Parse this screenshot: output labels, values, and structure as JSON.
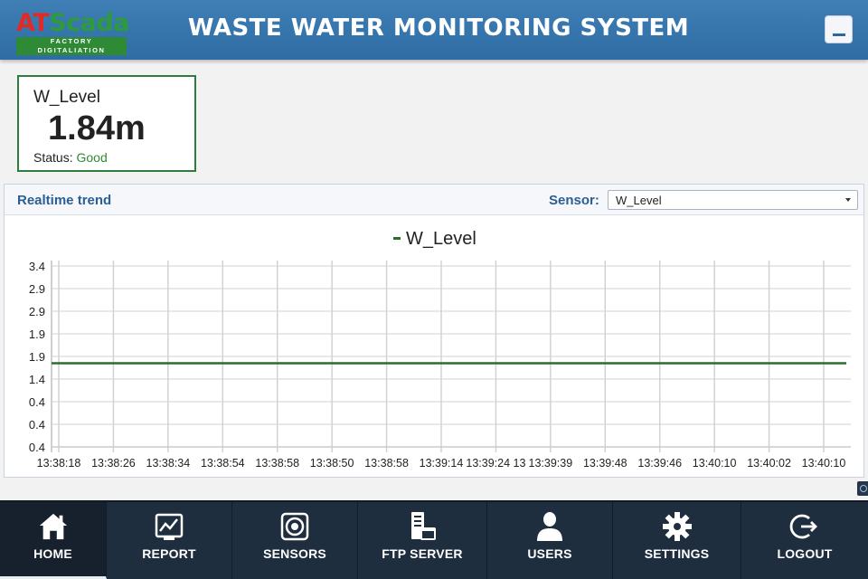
{
  "header": {
    "logo_at": "AT",
    "logo_scada": "Scada",
    "logo_tagline": "FACTORY DIGITALIATION",
    "title": "WASTE WATER MONITORING SYSTEM",
    "minimize_icon": "minimize-icon"
  },
  "value_card": {
    "label": "W_Level",
    "value": "1.84m",
    "status_label": "Status:",
    "status_value": "Good"
  },
  "trend": {
    "title": "Realtime trend",
    "sensor_label": "Sensor:",
    "sensor_selected": "W_Level"
  },
  "chart_data": {
    "type": "line",
    "legend": "W_Level",
    "legend_placement": "top-center",
    "grid": true,
    "series": [
      {
        "name": "W_Level",
        "color": "#2a6e2f",
        "values": [
          1.75,
          1.75,
          1.75,
          1.75,
          1.75,
          1.75,
          1.75,
          1.75,
          1.75,
          1.75,
          1.75,
          1.75,
          1.75,
          1.75,
          1.75,
          1.75
        ]
      }
    ],
    "y_ticks": [
      "3.4",
      "2.9",
      "2.9",
      "1.9",
      "1.9",
      "1.4",
      "0.4",
      "0.4",
      "0.4"
    ],
    "x_ticks": [
      "13:38:18",
      "13:38:26",
      "13:38:34",
      "13:38:54",
      "13:38:58",
      "13:38:50",
      "13:38:58",
      "13:39:14",
      "13:39:24 13",
      "13:39:39",
      "13:39:48",
      "13:39:46",
      "13:40:10",
      "13:40:02",
      "13:40:10"
    ]
  },
  "nav": {
    "items": [
      {
        "key": "home",
        "label": "HOME",
        "icon": "home-icon",
        "active": true
      },
      {
        "key": "report",
        "label": "REPORT",
        "icon": "report-chart-icon",
        "active": false
      },
      {
        "key": "sensors",
        "label": "SENSORS",
        "icon": "sensor-icon",
        "active": false
      },
      {
        "key": "ftp",
        "label": "FTP SERVER",
        "icon": "server-icon",
        "active": false
      },
      {
        "key": "users",
        "label": "USERS",
        "icon": "user-icon",
        "active": false
      },
      {
        "key": "settings",
        "label": "SETTINGS",
        "icon": "gear-icon",
        "active": false
      },
      {
        "key": "logout",
        "label": "LOGOUT",
        "icon": "logout-icon",
        "active": false
      }
    ]
  }
}
